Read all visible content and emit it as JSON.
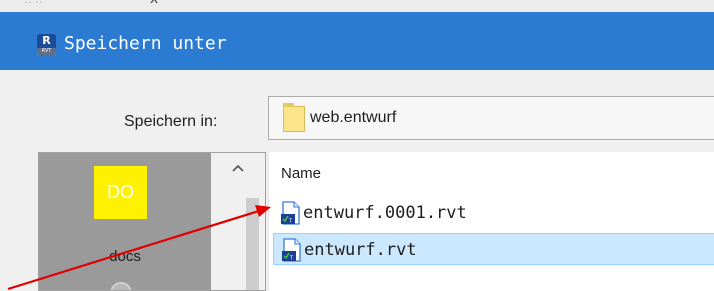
{
  "window": {
    "title": "Speichern unter",
    "app_icon": {
      "letter": "R",
      "caption": "RVT",
      "name": "revit-app-icon"
    }
  },
  "background": {
    "close_glyph": "x"
  },
  "save_in": {
    "label": "Speichern in:",
    "current_folder": "web.entwurf",
    "folder_icon": "folder-icon"
  },
  "places": {
    "items": [
      {
        "tile_text": "DO",
        "label": "docs",
        "tile_color": "#fff200"
      }
    ],
    "scroll_up_glyph": "^"
  },
  "file_list": {
    "column_header": "Name",
    "files": [
      {
        "name": "entwurf.0001.rvt",
        "icon": "rvt-file-icon",
        "selected": false
      },
      {
        "name": "entwurf.rvt",
        "icon": "rvt-file-icon",
        "selected": true
      }
    ]
  },
  "annotation": {
    "arrow_color": "#e00000"
  },
  "colors": {
    "titlebar": "#2b7bd3",
    "dialog_bg": "#f0f0f0",
    "selection_bg": "#cce8ff",
    "selection_border": "#99d1ff"
  }
}
